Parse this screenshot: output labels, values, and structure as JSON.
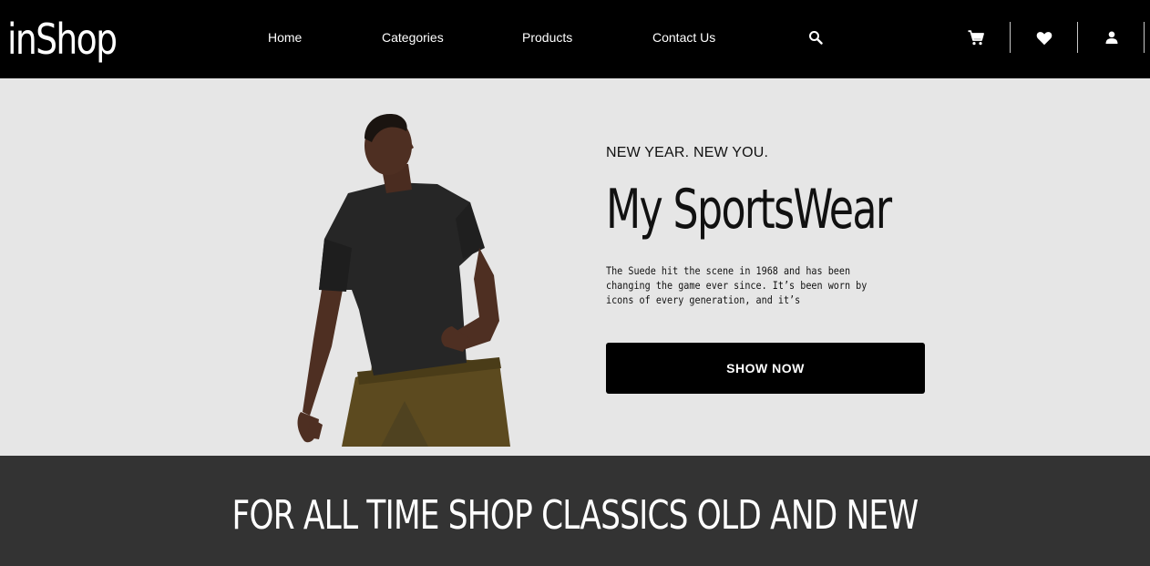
{
  "header": {
    "logo": "inShop",
    "nav": {
      "home": "Home",
      "categories": "Categories",
      "products": "Products",
      "contact": "Contact Us"
    },
    "icons": [
      "search-icon",
      "cart-icon",
      "heart-icon",
      "user-icon"
    ]
  },
  "hero": {
    "eyebrow": "NEW YEAR. NEW YOU.",
    "title": "My SportsWear",
    "description": "The Suede hit the scene in 1968 and has been changing the game ever since. It’s been worn by icons of every generation, and it’s",
    "cta": "SHOW NOW"
  },
  "banner": {
    "text": "FOR ALL TIME SHOP CLASSICS OLD AND NEW"
  },
  "colors": {
    "header_bg": "#000000",
    "hero_bg": "#e6e6e6",
    "banner_bg": "#333333",
    "button_bg": "#000000",
    "text_light": "#ffffff"
  }
}
